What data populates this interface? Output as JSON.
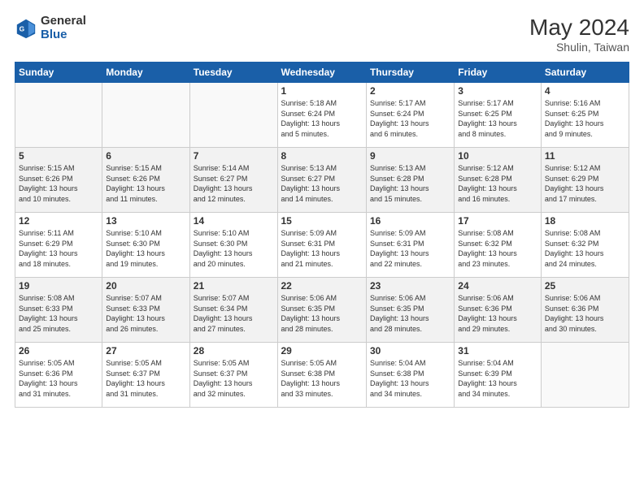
{
  "header": {
    "logo_general": "General",
    "logo_blue": "Blue",
    "title": "May 2024",
    "location": "Shulin, Taiwan"
  },
  "weekdays": [
    "Sunday",
    "Monday",
    "Tuesday",
    "Wednesday",
    "Thursday",
    "Friday",
    "Saturday"
  ],
  "weeks": [
    [
      {
        "day": "",
        "detail": ""
      },
      {
        "day": "",
        "detail": ""
      },
      {
        "day": "",
        "detail": ""
      },
      {
        "day": "1",
        "detail": "Sunrise: 5:18 AM\nSunset: 6:24 PM\nDaylight: 13 hours\nand 5 minutes."
      },
      {
        "day": "2",
        "detail": "Sunrise: 5:17 AM\nSunset: 6:24 PM\nDaylight: 13 hours\nand 6 minutes."
      },
      {
        "day": "3",
        "detail": "Sunrise: 5:17 AM\nSunset: 6:25 PM\nDaylight: 13 hours\nand 8 minutes."
      },
      {
        "day": "4",
        "detail": "Sunrise: 5:16 AM\nSunset: 6:25 PM\nDaylight: 13 hours\nand 9 minutes."
      }
    ],
    [
      {
        "day": "5",
        "detail": "Sunrise: 5:15 AM\nSunset: 6:26 PM\nDaylight: 13 hours\nand 10 minutes."
      },
      {
        "day": "6",
        "detail": "Sunrise: 5:15 AM\nSunset: 6:26 PM\nDaylight: 13 hours\nand 11 minutes."
      },
      {
        "day": "7",
        "detail": "Sunrise: 5:14 AM\nSunset: 6:27 PM\nDaylight: 13 hours\nand 12 minutes."
      },
      {
        "day": "8",
        "detail": "Sunrise: 5:13 AM\nSunset: 6:27 PM\nDaylight: 13 hours\nand 14 minutes."
      },
      {
        "day": "9",
        "detail": "Sunrise: 5:13 AM\nSunset: 6:28 PM\nDaylight: 13 hours\nand 15 minutes."
      },
      {
        "day": "10",
        "detail": "Sunrise: 5:12 AM\nSunset: 6:28 PM\nDaylight: 13 hours\nand 16 minutes."
      },
      {
        "day": "11",
        "detail": "Sunrise: 5:12 AM\nSunset: 6:29 PM\nDaylight: 13 hours\nand 17 minutes."
      }
    ],
    [
      {
        "day": "12",
        "detail": "Sunrise: 5:11 AM\nSunset: 6:29 PM\nDaylight: 13 hours\nand 18 minutes."
      },
      {
        "day": "13",
        "detail": "Sunrise: 5:10 AM\nSunset: 6:30 PM\nDaylight: 13 hours\nand 19 minutes."
      },
      {
        "day": "14",
        "detail": "Sunrise: 5:10 AM\nSunset: 6:30 PM\nDaylight: 13 hours\nand 20 minutes."
      },
      {
        "day": "15",
        "detail": "Sunrise: 5:09 AM\nSunset: 6:31 PM\nDaylight: 13 hours\nand 21 minutes."
      },
      {
        "day": "16",
        "detail": "Sunrise: 5:09 AM\nSunset: 6:31 PM\nDaylight: 13 hours\nand 22 minutes."
      },
      {
        "day": "17",
        "detail": "Sunrise: 5:08 AM\nSunset: 6:32 PM\nDaylight: 13 hours\nand 23 minutes."
      },
      {
        "day": "18",
        "detail": "Sunrise: 5:08 AM\nSunset: 6:32 PM\nDaylight: 13 hours\nand 24 minutes."
      }
    ],
    [
      {
        "day": "19",
        "detail": "Sunrise: 5:08 AM\nSunset: 6:33 PM\nDaylight: 13 hours\nand 25 minutes."
      },
      {
        "day": "20",
        "detail": "Sunrise: 5:07 AM\nSunset: 6:33 PM\nDaylight: 13 hours\nand 26 minutes."
      },
      {
        "day": "21",
        "detail": "Sunrise: 5:07 AM\nSunset: 6:34 PM\nDaylight: 13 hours\nand 27 minutes."
      },
      {
        "day": "22",
        "detail": "Sunrise: 5:06 AM\nSunset: 6:35 PM\nDaylight: 13 hours\nand 28 minutes."
      },
      {
        "day": "23",
        "detail": "Sunrise: 5:06 AM\nSunset: 6:35 PM\nDaylight: 13 hours\nand 28 minutes."
      },
      {
        "day": "24",
        "detail": "Sunrise: 5:06 AM\nSunset: 6:36 PM\nDaylight: 13 hours\nand 29 minutes."
      },
      {
        "day": "25",
        "detail": "Sunrise: 5:06 AM\nSunset: 6:36 PM\nDaylight: 13 hours\nand 30 minutes."
      }
    ],
    [
      {
        "day": "26",
        "detail": "Sunrise: 5:05 AM\nSunset: 6:36 PM\nDaylight: 13 hours\nand 31 minutes."
      },
      {
        "day": "27",
        "detail": "Sunrise: 5:05 AM\nSunset: 6:37 PM\nDaylight: 13 hours\nand 31 minutes."
      },
      {
        "day": "28",
        "detail": "Sunrise: 5:05 AM\nSunset: 6:37 PM\nDaylight: 13 hours\nand 32 minutes."
      },
      {
        "day": "29",
        "detail": "Sunrise: 5:05 AM\nSunset: 6:38 PM\nDaylight: 13 hours\nand 33 minutes."
      },
      {
        "day": "30",
        "detail": "Sunrise: 5:04 AM\nSunset: 6:38 PM\nDaylight: 13 hours\nand 34 minutes."
      },
      {
        "day": "31",
        "detail": "Sunrise: 5:04 AM\nSunset: 6:39 PM\nDaylight: 13 hours\nand 34 minutes."
      },
      {
        "day": "",
        "detail": ""
      }
    ]
  ]
}
